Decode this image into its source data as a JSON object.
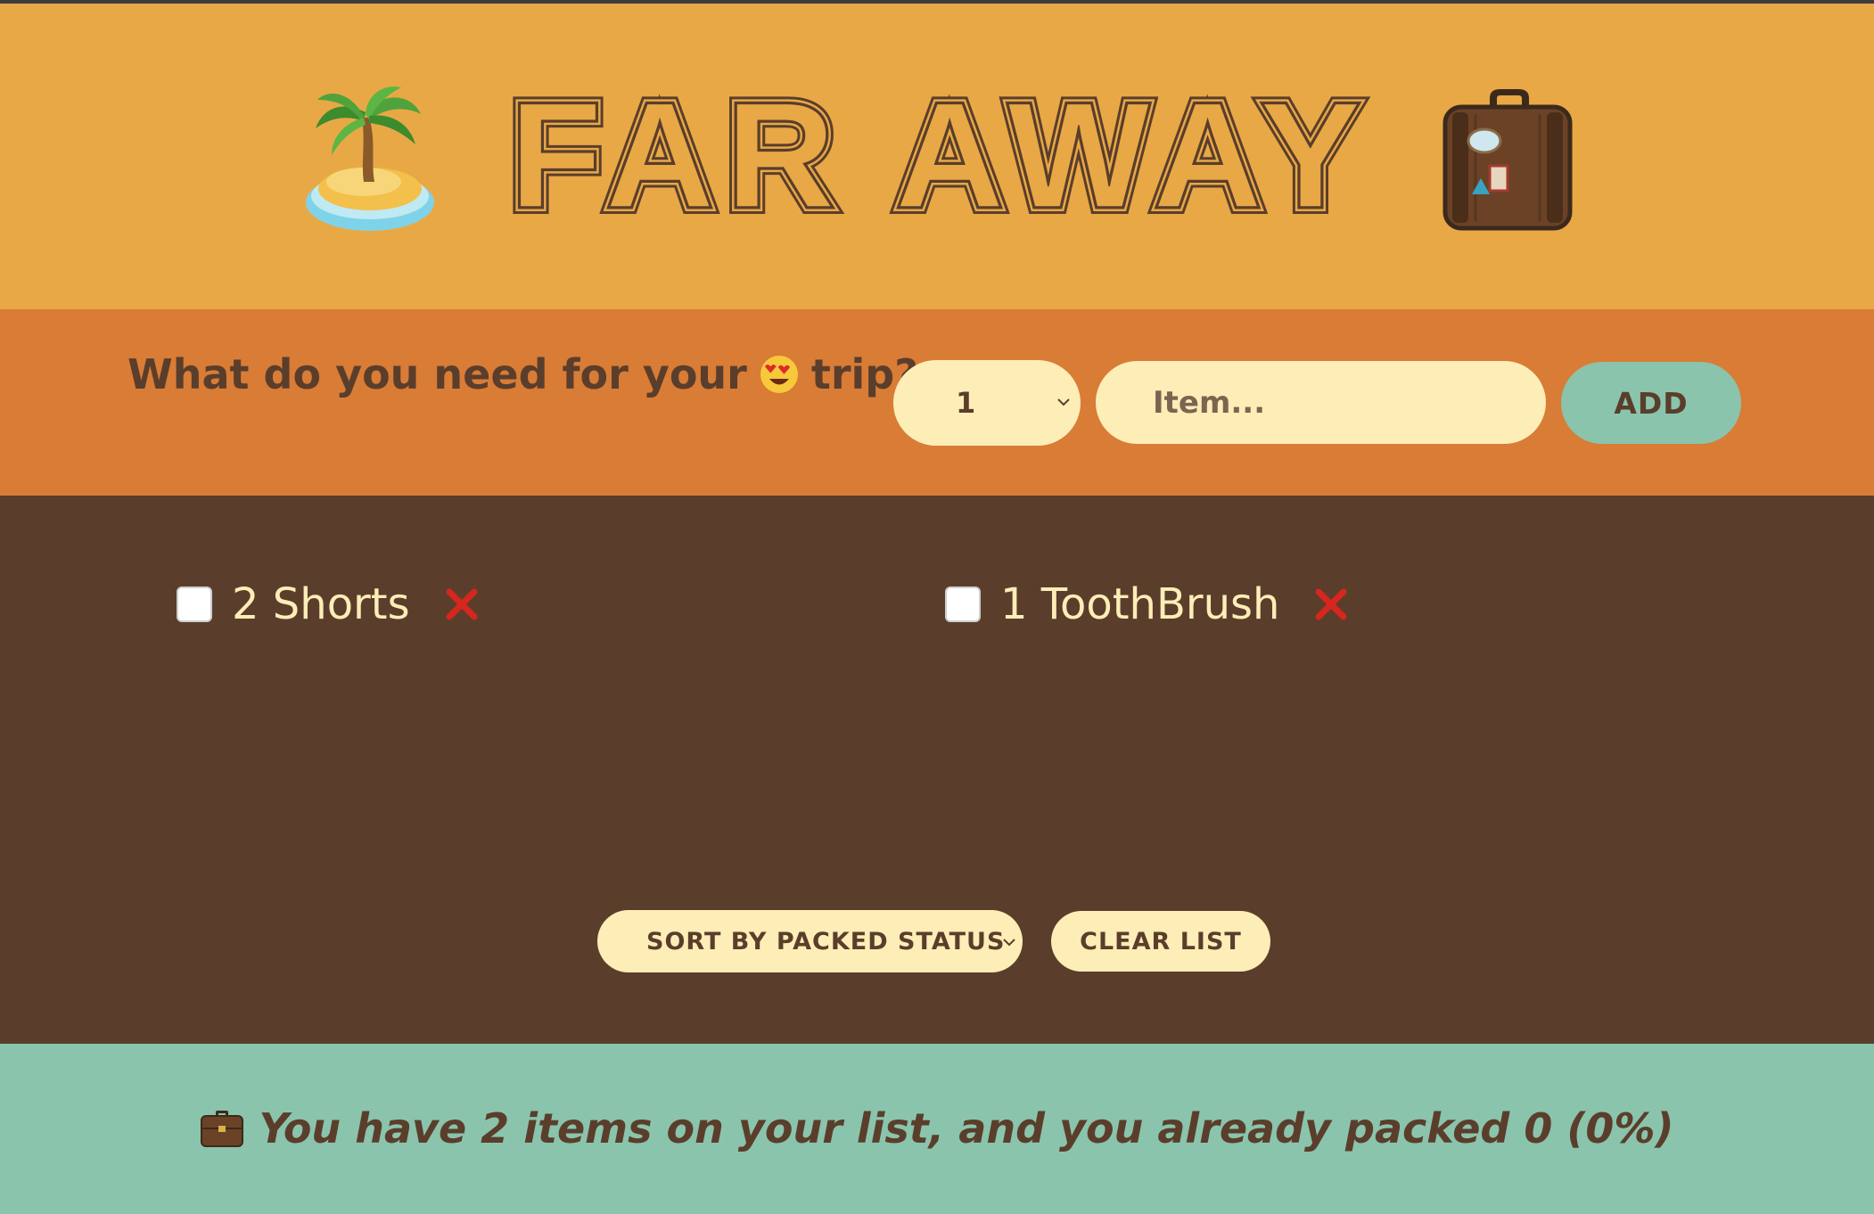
{
  "header": {
    "title": "FAR AWAY",
    "left_icon": "desert-island-icon",
    "right_icon": "suitcase-icon"
  },
  "form": {
    "question_before": "What do you need for your",
    "question_icon": "heart-eyes-emoji-icon",
    "question_after": "trip?",
    "quantity_value": "1",
    "item_placeholder": "Item...",
    "add_label": "ADD"
  },
  "items": [
    {
      "quantity": 2,
      "description": "Shorts",
      "label": "2 Shorts",
      "packed": false
    },
    {
      "quantity": 1,
      "description": "ToothBrush",
      "label": "1 ToothBrush",
      "packed": false
    }
  ],
  "actions": {
    "sort_value": "SORT BY PACKED STATUS",
    "clear_label": "CLEAR LIST"
  },
  "stats": {
    "icon": "briefcase-icon",
    "text": "You have 2 items on your list, and you already packed 0 (0%)",
    "total_items": 2,
    "packed_items": 0,
    "packed_percent": 0
  },
  "colors": {
    "header_bg": "#e9a846",
    "form_bg": "#d97c36",
    "list_bg": "#5a3e2b",
    "stats_bg": "#8ac4ad",
    "input_bg": "#fdedb7",
    "text_dark": "#5a3e2b",
    "item_text": "#fdedb7",
    "delete_red": "#d6261e"
  }
}
